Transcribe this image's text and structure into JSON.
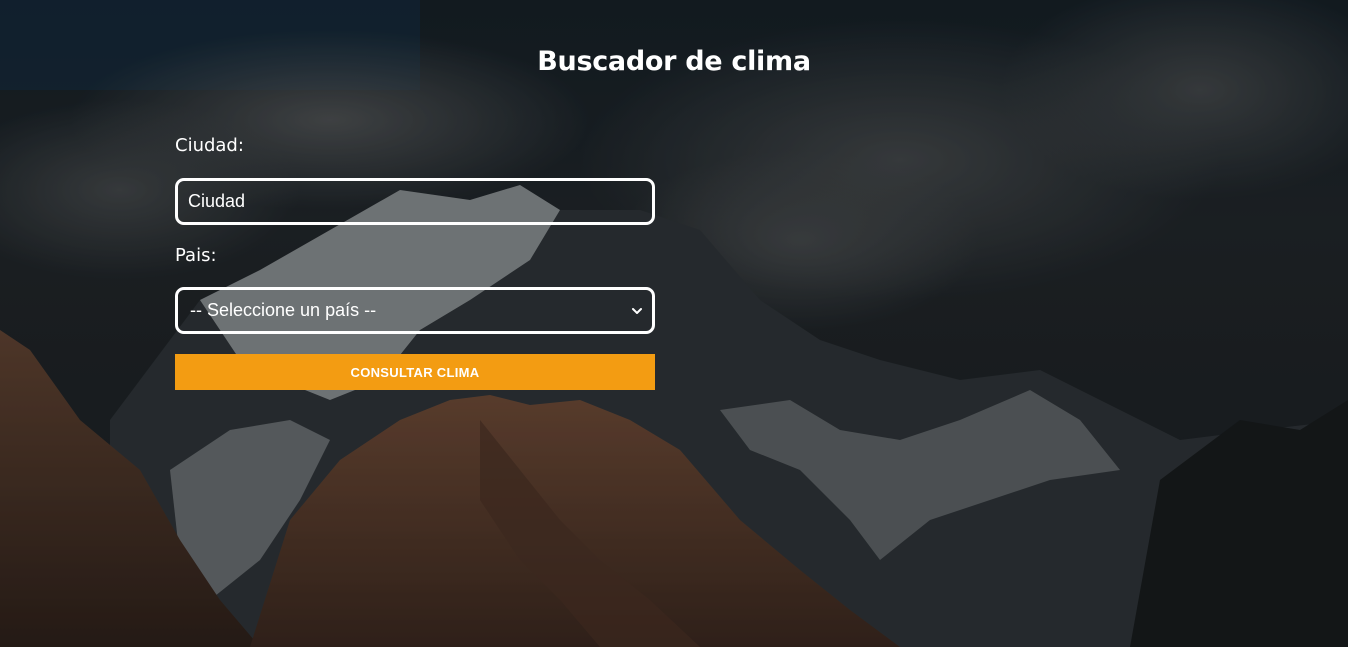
{
  "page": {
    "title": "Buscador de clima"
  },
  "form": {
    "city_label": "Ciudad:",
    "city_placeholder": "Ciudad",
    "country_label": "Pais:",
    "country_selected": "-- Seleccione un país --",
    "submit_label": "CONSULTAR CLIMA"
  },
  "colors": {
    "accent": "#f39c12",
    "text": "#ffffff"
  }
}
